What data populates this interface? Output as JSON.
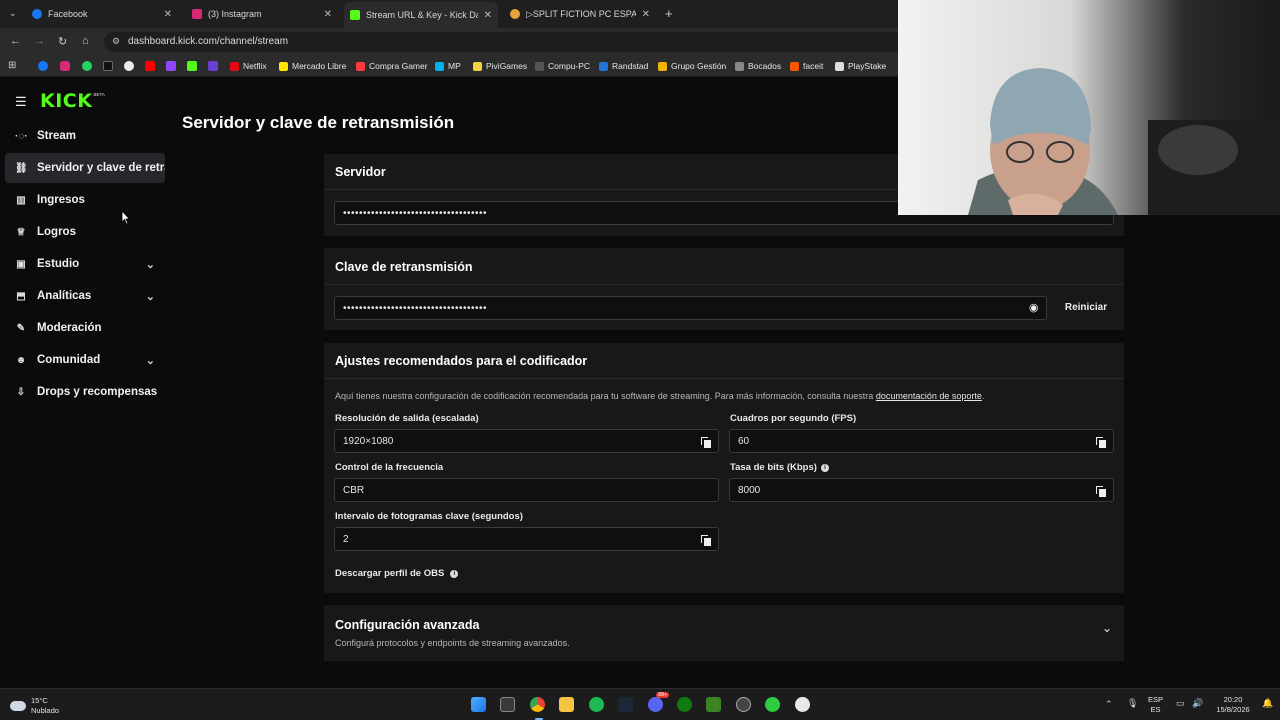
{
  "browser": {
    "tabs": [
      {
        "title": "Facebook",
        "color": "#1877f2",
        "active": false
      },
      {
        "title": "(3) Instagram",
        "color": "#d62976",
        "active": false
      },
      {
        "title": "Stream URL & Key - Kick Dashb",
        "color": "#53fc18",
        "active": true
      },
      {
        "title": "▷SPLIT FICTION PC ESPAÑOL -",
        "color": "#e8a33b",
        "active": false
      }
    ],
    "url": "dashboard.kick.com/channel/stream",
    "bookmarks": [
      {
        "label": "Netflix",
        "color": "#e50914"
      },
      {
        "label": "Mercado Libre",
        "color": "#ffe600"
      },
      {
        "label": "Compra Gamer",
        "color": "#ff3b3b"
      },
      {
        "label": "MP",
        "color": "#00b1ea"
      },
      {
        "label": "PiviGames",
        "color": "#f5d142"
      },
      {
        "label": "Compu-PC",
        "color": "#555555"
      },
      {
        "label": "Randstad",
        "color": "#2175d9"
      },
      {
        "label": "Grupo Gestión",
        "color": "#f2b705"
      },
      {
        "label": "Bocados",
        "color": "#888888"
      },
      {
        "label": "faceit",
        "color": "#ff5500"
      },
      {
        "label": "PlayStake",
        "color": "#dddddd"
      }
    ]
  },
  "sidebar": {
    "logo": "KICK",
    "logo_badge": "BETA",
    "items": [
      {
        "label": "Stream",
        "icon": "broadcast-icon",
        "glyph": "((·))",
        "chevron": false
      },
      {
        "label": "Servidor y clave de retransmisión",
        "icon": "link-icon",
        "glyph": "⛓",
        "chevron": false
      },
      {
        "label": "Ingresos",
        "icon": "revenue-icon",
        "glyph": "▥",
        "chevron": false
      },
      {
        "label": "Logros",
        "icon": "trophy-icon",
        "glyph": "🏆",
        "chevron": false
      },
      {
        "label": "Estudio",
        "icon": "studio-icon",
        "glyph": "▣",
        "chevron": true
      },
      {
        "label": "Analíticas",
        "icon": "analytics-icon",
        "glyph": "⬒",
        "chevron": true
      },
      {
        "label": "Moderación",
        "icon": "wrench-icon",
        "glyph": "🔧",
        "chevron": false
      },
      {
        "label": "Comunidad",
        "icon": "community-icon",
        "glyph": "👥",
        "chevron": true
      },
      {
        "label": "Drops y recompensas",
        "icon": "drops-icon",
        "glyph": "⇩",
        "chevron": false
      }
    ]
  },
  "main": {
    "title": "Servidor y clave de retransmisión",
    "server": {
      "heading": "Servidor",
      "value": "••••••••••••••••••••••••••••••••••••"
    },
    "stream_key": {
      "heading": "Clave de retransmisión",
      "value": "••••••••••••••••••••••••••••••••••••",
      "reset_label": "Reiniciar"
    },
    "encoder": {
      "heading": "Ajustes recomendados para el codificador",
      "description": "Aquí tienes nuestra configuración de codificación recomendada para tu software de streaming. Para más información, consulta nuestra",
      "doc_link": "documentación de soporte",
      "resolution_label": "Resolución de salida (escalada)",
      "resolution_value": "1920×1080",
      "fps_label": "Cuadros por segundo (FPS)",
      "fps_value": "60",
      "rate_control_label": "Control de la frecuencia",
      "rate_control_value": "CBR",
      "bitrate_label": "Tasa de bits (Kbps)",
      "bitrate_value": "8000",
      "keyframe_label": "Intervalo de fotogramas clave (segundos)",
      "keyframe_value": "2",
      "obs_profile_label": "Descargar perfil de OBS"
    },
    "advanced": {
      "heading": "Configuración avanzada",
      "subtitle": "Configurá protocolos y endpoints de streaming avanzados."
    }
  },
  "taskbar": {
    "weather_temp": "15°C",
    "weather_desc": "Nublado",
    "lang_top": "ESP",
    "lang_bottom": "ES",
    "time": "20:20",
    "date": "15/8/2026",
    "badge": "99+"
  }
}
